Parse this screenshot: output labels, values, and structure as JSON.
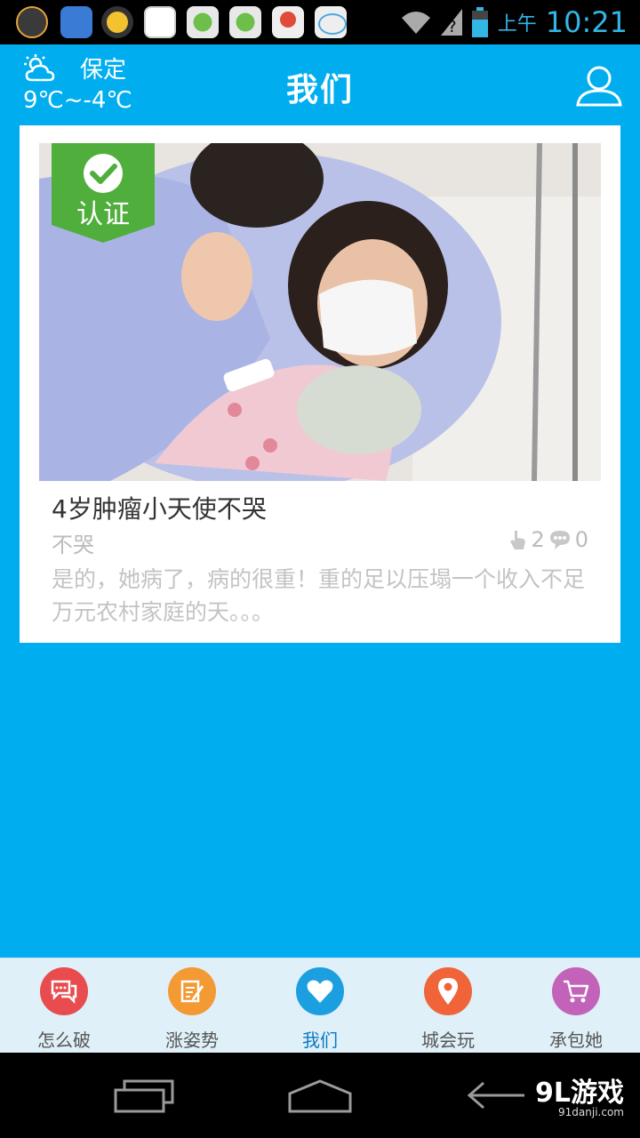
{
  "status_bar": {
    "ampm": "上午",
    "time": "10:21",
    "app_icon_colors": [
      "#e8a33a",
      "#3a7bd5",
      "#f2c230",
      "#ffffff",
      "#6cc04a",
      "#6cc04a",
      "#e04a3a",
      "#4aa8e0"
    ]
  },
  "header": {
    "city": "保定",
    "temperature": "9℃~-4℃",
    "title": "我们"
  },
  "card": {
    "badge_label": "认证",
    "title": "4岁肿瘤小天使不哭",
    "subtitle": "不哭",
    "likes": "2",
    "comments": "0",
    "description": "是的，她病了，病的很重！重的足以压塌一个收入不足万元农村家庭的天。。。"
  },
  "tabs": [
    {
      "label": "怎么破",
      "icon": "chat-icon",
      "color": "#e84c4f"
    },
    {
      "label": "涨姿势",
      "icon": "edit-icon",
      "color": "#f39a34"
    },
    {
      "label": "我们",
      "icon": "heart-icon",
      "color": "#1b9fe0"
    },
    {
      "label": "城会玩",
      "icon": "location-icon",
      "color": "#f0643a"
    },
    {
      "label": "承包她",
      "icon": "cart-icon",
      "color": "#c262b8"
    }
  ],
  "watermark": {
    "text": "9L游戏",
    "sub": "91danji.com"
  }
}
